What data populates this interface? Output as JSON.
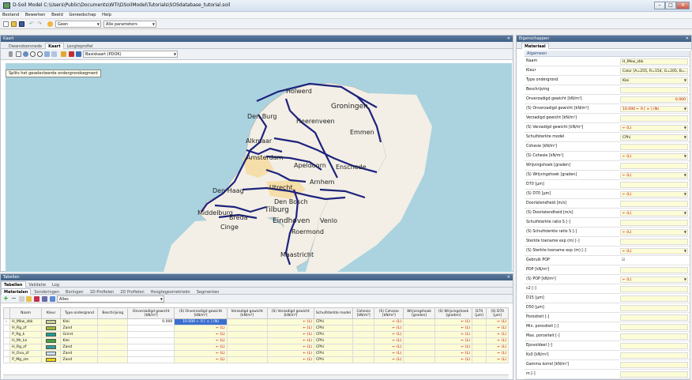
{
  "window": {
    "title": "D-Soil Model  C:\\Users\\Public\\Documents\\WTI\\DSoilModel\\Tutorials\\SOSdatabase_tutorial.soil"
  },
  "menu": [
    "Bestand",
    "Bewerken",
    "Beeld",
    "Gereedschap",
    "Help"
  ],
  "toolbar": {
    "combo1": "Geen",
    "combo2": "Alle parameters"
  },
  "kaart_panel": {
    "title": "Kaart",
    "tabs": [
      "Dwarsdoorsnede",
      "Kaart",
      "Lengteprofiel"
    ],
    "active_tab": "Kaart",
    "basemap": "Basiskaart (PDOK)",
    "tooltip": "Splits het geselecteerde ondergrondsegment"
  },
  "map": {
    "cities": [
      "Holwerd",
      "Groningen",
      "Den Burg",
      "Heerenveen",
      "Emmen",
      "Alkmaar",
      "Amsterdam",
      "Apeldoorn",
      "Enschede",
      "Arnhem",
      "Den Haag",
      "Utrecht",
      "Den Bosch",
      "Tilburg",
      "Eindhoven",
      "Venlo",
      "Middelburg",
      "Breda",
      "Cinge",
      "Roermond",
      "Maastricht"
    ],
    "colors": {
      "sea": "#aad3df",
      "land": "#f3efe6",
      "segment": "#1d237d"
    }
  },
  "tabellen_panel": {
    "title": "Tabellen",
    "outer_tabs": [
      "Tabellen",
      "Validatie",
      "Log"
    ],
    "active_outer": "Tabellen",
    "tabs": [
      "Materialen",
      "Sonderingen",
      "Boringen",
      "1D-Profielen",
      "2D Profielen",
      "Hoogtegeometrieën",
      "Segmenten"
    ],
    "active_tab": "Materialen",
    "filter": "Alles",
    "columns": [
      "Naam",
      "Kleur",
      "Type ondergrond",
      "Beschrijving",
      "Onverzadigd gewicht [kN/m³]",
      "(S) Onverzadigd gewicht [kN/m³]",
      "Verzadigd gewicht [kN/m³]",
      "(S) Verzadigd gewicht [kN/m³]",
      "Schuifsterkte model",
      "Cohesie [kN/m²]",
      "(S) Cohesie [kN/m²]",
      "Wrijvingshoek [graden]",
      "(S) Wrijvingshoek [graden]",
      "D70 [μm]",
      "(S) D70 [μm]"
    ],
    "rows": [
      {
        "naam": "H_Mkw_zbk",
        "kleur": "#c9d39a",
        "type": "Klei",
        "onv": "0.000",
        "s_onv": "10.000 ← 0 [ ≈ ] (N)",
        "s_verz": "← (L)",
        "model": "CPhi",
        "s_coh": "← (L)",
        "s_wr": "← (L)",
        "s_d70": "← (L)"
      },
      {
        "naam": "H_Rg_zf",
        "kleur": "#9bbf3a",
        "type": "Zand",
        "onv": "",
        "s_onv": "← (L)",
        "s_verz": "← (L)",
        "model": "CPhi",
        "s_coh": "← (L)",
        "s_wr": "← (L)",
        "s_d70": "← (L)"
      },
      {
        "naam": "P_Rg_k",
        "kleur": "#1f9c8f",
        "type": "Grind",
        "onv": "",
        "s_onv": "← (L)",
        "s_verz": "← (L)",
        "model": "CPhi",
        "s_coh": "← (L)",
        "s_wr": "← (L)",
        "s_d70": "← (L)"
      },
      {
        "naam": "H_Mr_kz",
        "kleur": "#3fa33f",
        "type": "Klei",
        "onv": "",
        "s_onv": "← (L)",
        "s_verz": "← (L)",
        "model": "CPhi",
        "s_coh": "← (L)",
        "s_wr": "← (L)",
        "s_d70": "← (L)"
      },
      {
        "naam": "H_Rg_zf",
        "kleur": "#2f9d9d",
        "type": "Zand",
        "onv": "",
        "s_onv": "← (L)",
        "s_verz": "← (L)",
        "model": "CPhi",
        "s_coh": "← (L)",
        "s_wr": "← (L)",
        "s_d70": "← (L)"
      },
      {
        "naam": "H_Ova_zf",
        "kleur": "#cfe3ff",
        "type": "Zand",
        "onv": "",
        "s_onv": "← (L)",
        "s_verz": "← (L)",
        "model": "CPhi",
        "s_coh": "← (L)",
        "s_wr": "← (L)",
        "s_d70": "← (L)"
      },
      {
        "naam": "P_Mg_zm",
        "kleur": "#f0d200",
        "type": "Zand",
        "onv": "",
        "s_onv": "← (L)",
        "s_verz": "← (L)",
        "model": "CPhi",
        "s_coh": "← (L)",
        "s_wr": "← (L)",
        "s_d70": "← (L)"
      }
    ]
  },
  "properties_panel": {
    "title": "Eigenschappen",
    "tab": "Materiaal",
    "category": "Algemeen",
    "rows": [
      {
        "label": "Naam",
        "value": "H_Mkw_zbk",
        "red": false,
        "dd": false
      },
      {
        "label": "Kleur",
        "value": "Color [A=255, R=154, G=205, B=...",
        "red": false,
        "dd": false
      },
      {
        "label": "Type ondergrond",
        "value": "Klei",
        "red": false,
        "dd": true
      },
      {
        "label": "Beschrijving",
        "value": "",
        "red": false,
        "dd": false
      },
      {
        "label": "Onverzadigd gewicht [kN/m³]",
        "value": "0.000",
        "red": true,
        "dd": false
      },
      {
        "label": "(S) Onverzadigd gewicht [kN/m³]",
        "value": "10.000 ← 0 [ ≈ ] (N)",
        "red": true,
        "dd": true
      },
      {
        "label": "Verzadigd gewicht [kN/m³]",
        "value": "",
        "red": false,
        "dd": false
      },
      {
        "label": "(S) Verzadigd gewicht [kN/m³]",
        "value": "← (L)",
        "red": true,
        "dd": true
      },
      {
        "label": "Schuifsterkte model",
        "value": "CPhi",
        "red": false,
        "dd": true
      },
      {
        "label": "Cohesie [kN/m²]",
        "value": "",
        "red": false,
        "dd": false
      },
      {
        "label": "(S) Cohesie [kN/m²]",
        "value": "← (L)",
        "red": true,
        "dd": true
      },
      {
        "label": "Wrijvingshoek [graden]",
        "value": "",
        "red": false,
        "dd": false
      },
      {
        "label": "(S) Wrijvingshoek [graden]",
        "value": "← (L)",
        "red": true,
        "dd": true
      },
      {
        "label": "D70 [μm]",
        "value": "",
        "red": false,
        "dd": false
      },
      {
        "label": "(S) D70 [μm]",
        "value": "← (L)",
        "red": true,
        "dd": true
      },
      {
        "label": "Doorlatendheid [m/s]",
        "value": "",
        "red": false,
        "dd": false
      },
      {
        "label": "(S) Doorlatendheid [m/s]",
        "value": "← (L)",
        "red": true,
        "dd": true
      },
      {
        "label": "Schuifsterkte ratio S [-]",
        "value": "",
        "red": false,
        "dd": false
      },
      {
        "label": "(S) Schuifsterkte ratio S [-]",
        "value": "← (L)",
        "red": true,
        "dd": true
      },
      {
        "label": "Sterkte toename exp (m) [-]",
        "value": "",
        "red": false,
        "dd": false
      },
      {
        "label": "(S) Sterkte toename exp (m) [-]",
        "value": "← (L)",
        "red": true,
        "dd": true
      },
      {
        "label": "Gebruik POP",
        "value": "☑",
        "red": false,
        "dd": false
      },
      {
        "label": "POP [kN/m²]",
        "value": "",
        "red": false,
        "dd": false
      },
      {
        "label": "(S) POP [kN/m²]",
        "value": "← (L)",
        "red": true,
        "dd": true
      },
      {
        "label": "c2 [-]",
        "value": "",
        "red": false,
        "dd": false
      },
      {
        "label": "D15 [μm]",
        "value": "",
        "red": false,
        "dd": false
      },
      {
        "label": "D50 [μm]",
        "value": "",
        "red": false,
        "dd": false
      },
      {
        "label": "Porositeit [-]",
        "value": "",
        "red": false,
        "dd": false
      },
      {
        "label": "Min. porositeit [-]",
        "value": "",
        "red": false,
        "dd": false
      },
      {
        "label": "Max. porositeit [-]",
        "value": "",
        "red": false,
        "dd": false
      },
      {
        "label": "Epsvoldeel [-]",
        "value": "",
        "red": false,
        "dd": false
      },
      {
        "label": "Ks0 [kN/m³]",
        "value": "",
        "red": false,
        "dd": false
      },
      {
        "label": "Gamma korrel [kN/m³]",
        "value": "",
        "red": false,
        "dd": false
      },
      {
        "label": "m [-]",
        "value": "",
        "red": false,
        "dd": false
      }
    ]
  }
}
